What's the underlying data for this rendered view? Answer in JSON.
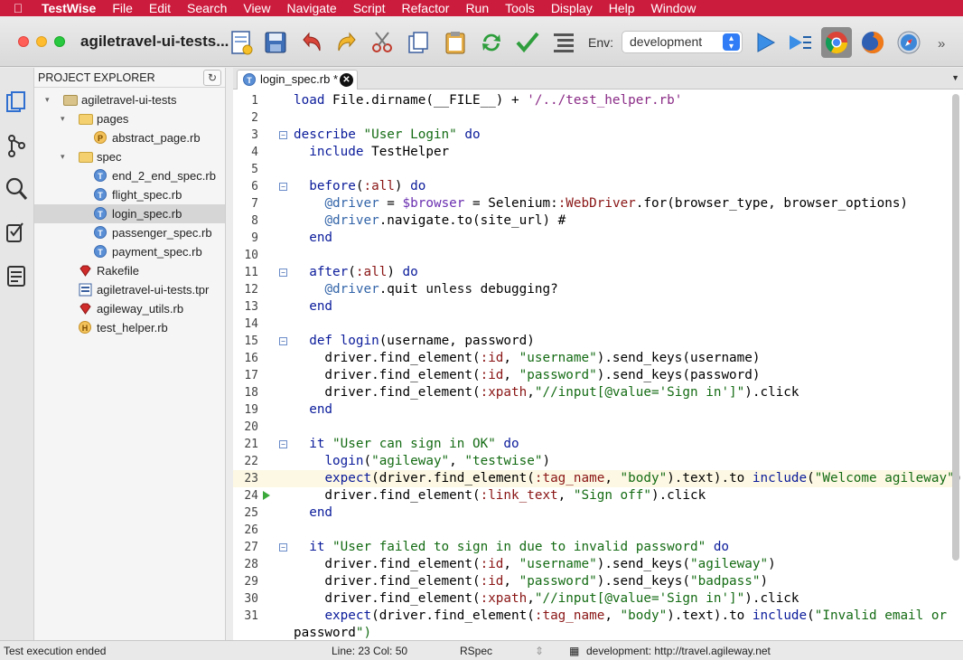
{
  "menubar": {
    "app_name": "TestWise",
    "items": [
      "File",
      "Edit",
      "Search",
      "View",
      "Navigate",
      "Script",
      "Refactor",
      "Run",
      "Tools",
      "Display",
      "Help",
      "Window"
    ]
  },
  "window": {
    "title": "agiletravel-ui-tests..."
  },
  "toolbar": {
    "buttons": [
      "new-file",
      "save",
      "undo",
      "redo",
      "cut",
      "copy",
      "paste",
      "refresh",
      "check",
      "format"
    ],
    "env_label": "Env:",
    "env_value": "development",
    "run_buttons": [
      "run",
      "run-all",
      "chrome",
      "firefox",
      "safari"
    ]
  },
  "explorer": {
    "title": "PROJECT EXPLORER",
    "tree": [
      {
        "label": "agiletravel-ui-tests",
        "type": "project",
        "depth": 0,
        "expanded": true
      },
      {
        "label": "pages",
        "type": "folder",
        "depth": 1,
        "expanded": true
      },
      {
        "label": "abstract_page.rb",
        "type": "page",
        "depth": 2
      },
      {
        "label": "spec",
        "type": "folder",
        "depth": 1,
        "expanded": true
      },
      {
        "label": "end_2_end_spec.rb",
        "type": "test",
        "depth": 2
      },
      {
        "label": "flight_spec.rb",
        "type": "test",
        "depth": 2
      },
      {
        "label": "login_spec.rb",
        "type": "test",
        "depth": 2,
        "selected": true
      },
      {
        "label": "passenger_spec.rb",
        "type": "test",
        "depth": 2
      },
      {
        "label": "payment_spec.rb",
        "type": "test",
        "depth": 2
      },
      {
        "label": "Rakefile",
        "type": "ruby",
        "depth": 1
      },
      {
        "label": "agiletravel-ui-tests.tpr",
        "type": "tpr",
        "depth": 1
      },
      {
        "label": "agileway_utils.rb",
        "type": "ruby",
        "depth": 1
      },
      {
        "label": "test_helper.rb",
        "type": "helper",
        "depth": 1
      }
    ]
  },
  "editor": {
    "tab_label": "login_spec.rb *",
    "current_line": 23,
    "exec_line": 24,
    "lines": [
      {
        "n": "1",
        "fold": false,
        "text": "load File.dirname(__FILE__) + '/../test_helper.rb'"
      },
      {
        "n": "2",
        "fold": false,
        "text": ""
      },
      {
        "n": "3",
        "fold": true,
        "text": "describe \"User Login\" do"
      },
      {
        "n": "4",
        "fold": false,
        "text": "  include TestHelper"
      },
      {
        "n": "5",
        "fold": false,
        "text": ""
      },
      {
        "n": "6",
        "fold": true,
        "text": "  before(:all) do"
      },
      {
        "n": "7",
        "fold": false,
        "text": "    @driver = $browser = Selenium::WebDriver.for(browser_type, browser_options)"
      },
      {
        "n": "8",
        "fold": false,
        "text": "    @driver.navigate.to(site_url) #"
      },
      {
        "n": "9",
        "fold": false,
        "text": "  end"
      },
      {
        "n": "10",
        "fold": false,
        "text": ""
      },
      {
        "n": "11",
        "fold": true,
        "text": "  after(:all) do"
      },
      {
        "n": "12",
        "fold": false,
        "text": "    @driver.quit unless debugging?"
      },
      {
        "n": "13",
        "fold": false,
        "text": "  end"
      },
      {
        "n": "14",
        "fold": false,
        "text": ""
      },
      {
        "n": "15",
        "fold": true,
        "text": "  def login(username, password)"
      },
      {
        "n": "16",
        "fold": false,
        "text": "    driver.find_element(:id, \"username\").send_keys(username)"
      },
      {
        "n": "17",
        "fold": false,
        "text": "    driver.find_element(:id, \"password\").send_keys(password)"
      },
      {
        "n": "18",
        "fold": false,
        "text": "    driver.find_element(:xpath,\"//input[@value='Sign in']\").click"
      },
      {
        "n": "19",
        "fold": false,
        "text": "  end"
      },
      {
        "n": "20",
        "fold": false,
        "text": ""
      },
      {
        "n": "21",
        "fold": true,
        "text": "  it \"User can sign in OK\" do"
      },
      {
        "n": "22",
        "fold": false,
        "text": "    login(\"agileway\", \"testwise\")"
      },
      {
        "n": "23",
        "fold": false,
        "text": "    expect(driver.find_element(:tag_name, \"body\").text).to include(\"Welcome agileway\")"
      },
      {
        "n": "24",
        "fold": false,
        "text": "    driver.find_element(:link_text, \"Sign off\").click"
      },
      {
        "n": "25",
        "fold": false,
        "text": "  end"
      },
      {
        "n": "26",
        "fold": false,
        "text": ""
      },
      {
        "n": "27",
        "fold": true,
        "text": "  it \"User failed to sign in due to invalid password\" do"
      },
      {
        "n": "28",
        "fold": false,
        "text": "    driver.find_element(:id, \"username\").send_keys(\"agileway\")"
      },
      {
        "n": "29",
        "fold": false,
        "text": "    driver.find_element(:id, \"password\").send_keys(\"badpass\")"
      },
      {
        "n": "30",
        "fold": false,
        "text": "    driver.find_element(:xpath,\"//input[@value='Sign in']\").click"
      },
      {
        "n": "31",
        "fold": false,
        "text": "    expect(driver.find_element(:tag_name, \"body\").text).to include(\"Invalid email or"
      },
      {
        "n": "",
        "fold": false,
        "text": "password\")"
      }
    ]
  },
  "statusbar": {
    "message": "Test execution ended",
    "position": "Line: 23  Col: 50",
    "framework": "RSpec",
    "environment": "development: http://travel.agileway.net"
  },
  "colors": {
    "menubar": "#cc1c3d",
    "keyword": "#0a1b9a",
    "string": "#146b14",
    "symbol": "#8a1515",
    "current_line": "#fdf8e3"
  }
}
